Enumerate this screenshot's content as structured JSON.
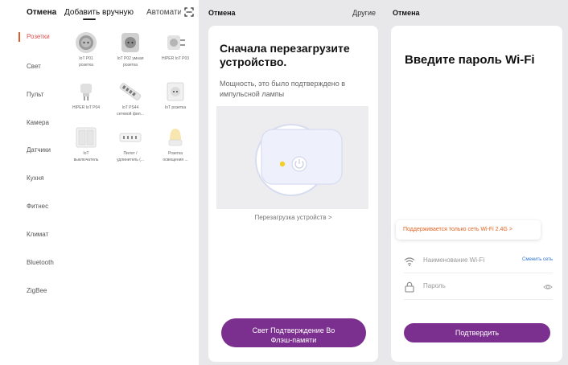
{
  "add_device": {
    "header": {
      "cancel": "Отмена",
      "tab_manual": "Добавить вручную",
      "tab_auto": "Автоматически"
    },
    "categories": [
      {
        "label": "Розетки",
        "active": true
      },
      {
        "label": "Свет",
        "active": false
      },
      {
        "label": "Пульт",
        "active": false
      },
      {
        "label": "Камера",
        "active": false
      },
      {
        "label": "Датчики",
        "active": false
      },
      {
        "label": "Кухня",
        "active": false
      },
      {
        "label": "Фитнес",
        "active": false
      },
      {
        "label": "Климат",
        "active": false
      },
      {
        "label": "Bluetooth",
        "active": false
      },
      {
        "label": "ZigBee",
        "active": false
      }
    ],
    "devices": [
      {
        "line1": "IoT P01",
        "line2": "розетка",
        "icon": "round-socket-icon"
      },
      {
        "line1": "IoT P02 умная",
        "line2": "розетка",
        "icon": "square-socket-icon"
      },
      {
        "line1": "HIPER IoT P03",
        "line2": "",
        "icon": "plug-adapter-icon"
      },
      {
        "line1": "HIPER IoT P04",
        "line2": "",
        "icon": "plug-icon"
      },
      {
        "line1": "IoT PS44",
        "line2": "сетевой фил...",
        "icon": "power-strip-icon"
      },
      {
        "line1": "IoT розетка",
        "line2": "",
        "icon": "wall-socket-icon"
      },
      {
        "line1": "IoT",
        "line2": "выключатель",
        "icon": "wall-switch-icon"
      },
      {
        "line1": "Пилот /",
        "line2": "удлинитель (...",
        "icon": "extension-cord-icon"
      },
      {
        "line1": "Розетка",
        "line2": "освещения ...",
        "icon": "night-light-icon"
      }
    ]
  },
  "reset_screen": {
    "cancel": "Отмена",
    "other": "Другие",
    "title": "Сначала перезагрузите устройство.",
    "description": "Мощность, это было подтверждено в импульсной лампы",
    "reset_link": "Перезагрузка устройств >",
    "confirm_button_line1": "Свет Подтверждение Во",
    "confirm_button_line2": "Флэш-памяти"
  },
  "wifi_screen": {
    "cancel": "Отмена",
    "title": "Введите пароль Wi-Fi",
    "warning": "Поддерживается только сеть Wi-Fi 2.4G >",
    "wifi_placeholder": "Наименование Wi-Fi",
    "change_network": "Сменить сеть",
    "password_placeholder": "Пароль",
    "confirm_button": "Подтвердить"
  },
  "colors": {
    "accent_purple": "#7b2f8e",
    "warning_orange": "#e2611f",
    "active_category": "#d9534f",
    "link_blue": "#2f72d8",
    "led_yellow": "#f2cf2a"
  }
}
